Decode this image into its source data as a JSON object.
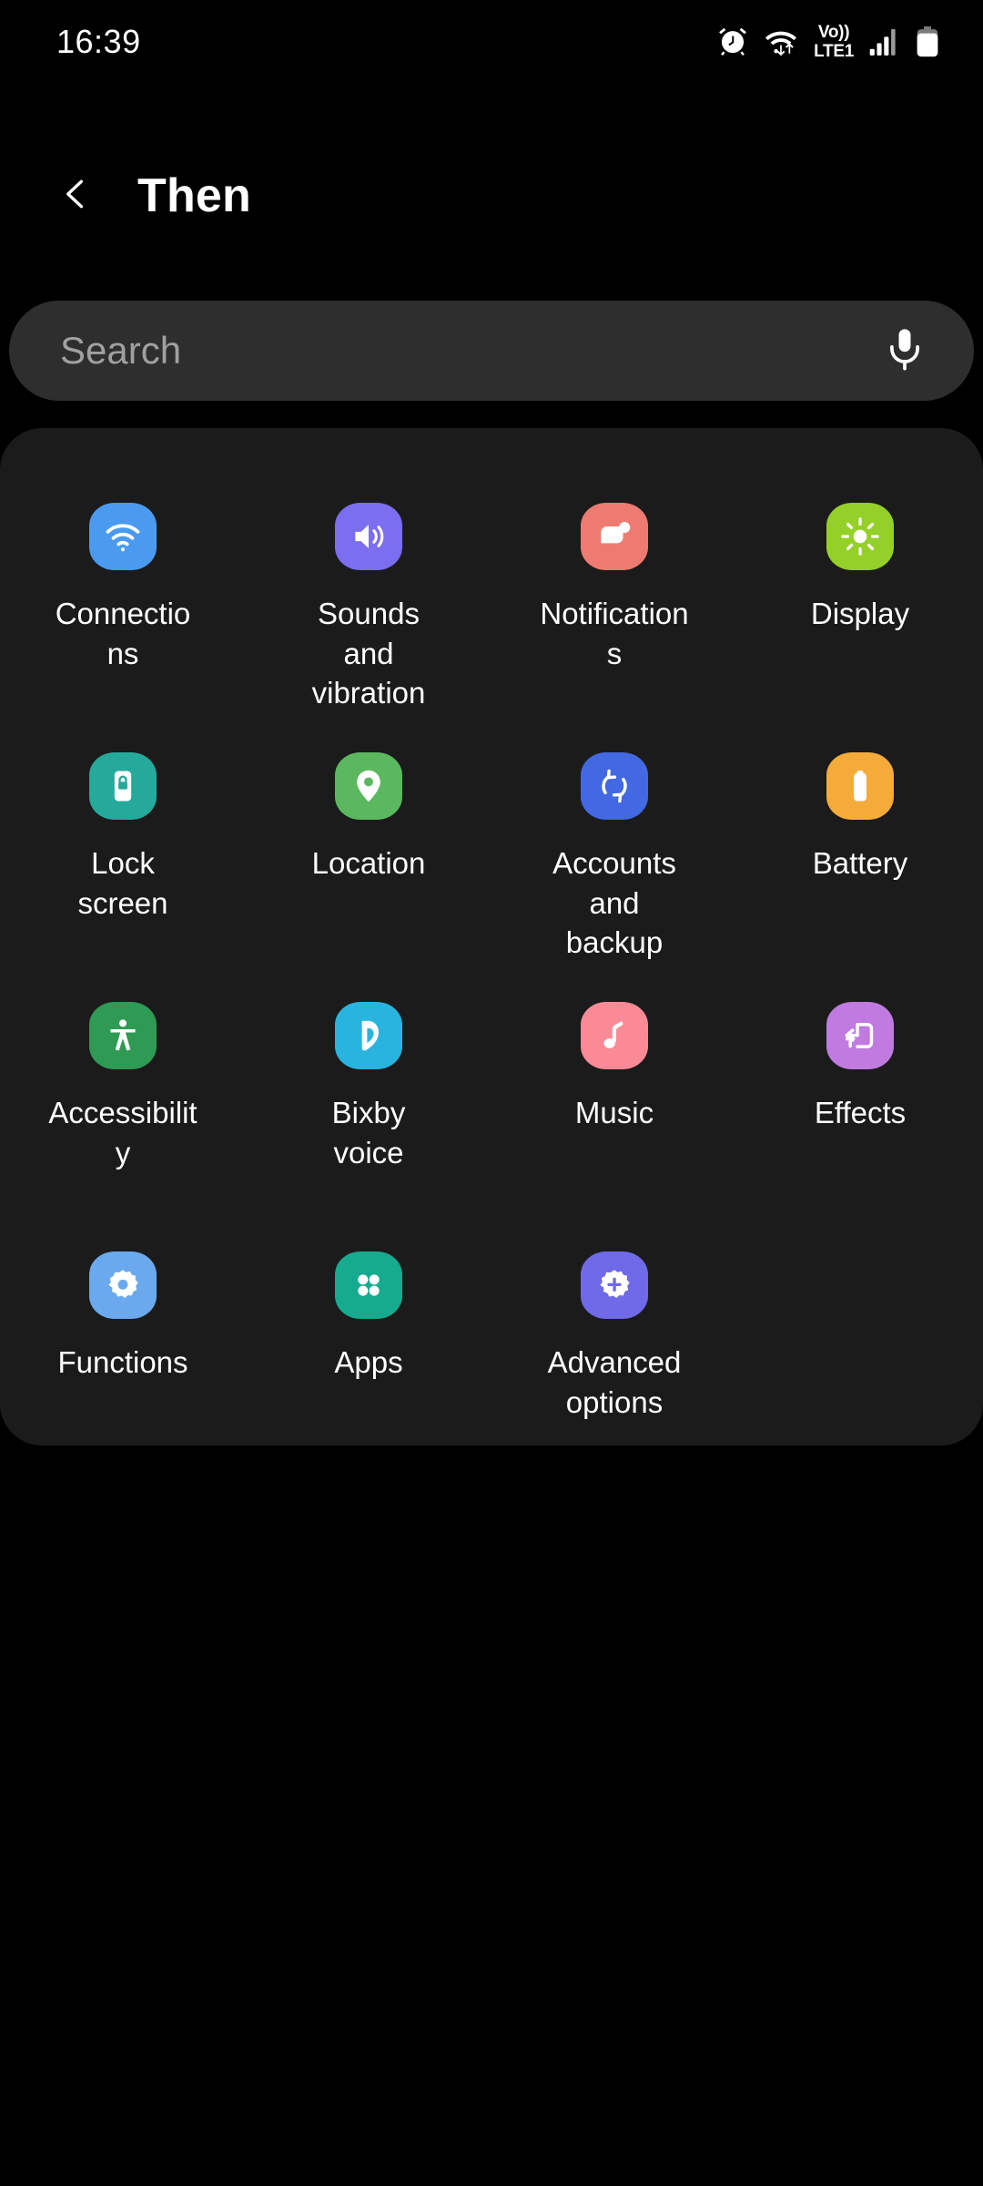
{
  "statusbar": {
    "clock": "16:39",
    "icons": [
      {
        "name": "alarm-icon"
      },
      {
        "name": "wifi-data-transfer-icon"
      },
      {
        "name": "volte-icon",
        "line1": "Vo))",
        "line2": "LTE1"
      },
      {
        "name": "signal-bars-icon"
      },
      {
        "name": "battery-icon"
      }
    ]
  },
  "appbar": {
    "back_icon": "chevron-left-icon",
    "title": "Then"
  },
  "search": {
    "placeholder": "Search",
    "value": "",
    "mic_icon": "microphone-icon"
  },
  "grid": {
    "items": [
      {
        "label": "Connections",
        "icon": "wifi-icon",
        "color": "#4a9bf0"
      },
      {
        "label": "Sounds and vibration",
        "icon": "speaker-volume-icon",
        "color": "#7b6ef0"
      },
      {
        "label": "Notifications",
        "icon": "notification-bubble-icon",
        "color": "#ed7b72"
      },
      {
        "label": "Display",
        "icon": "brightness-sun-icon",
        "color": "#94d027"
      },
      {
        "label": "Lock screen",
        "icon": "lock-icon",
        "color": "#25a99a"
      },
      {
        "label": "Location",
        "icon": "location-pin-icon",
        "color": "#5bb85e"
      },
      {
        "label": "Accounts and backup",
        "icon": "sync-arrows-icon",
        "color": "#4268e2"
      },
      {
        "label": "Battery",
        "icon": "battery-vertical-icon",
        "color": "#f5ab3a"
      },
      {
        "label": "Accessibility",
        "icon": "accessibility-person-icon",
        "color": "#2e9a54"
      },
      {
        "label": "Bixby voice",
        "icon": "bixby-icon",
        "color": "#28b4de"
      },
      {
        "label": "Music",
        "icon": "music-note-icon",
        "color": "#f98a96"
      },
      {
        "label": "Effects",
        "icon": "effects-device-icon",
        "color": "#c07ae0"
      },
      {
        "label": "Functions",
        "icon": "gear-icon",
        "color": "#6aa9ee"
      },
      {
        "label": "Apps",
        "icon": "apps-grid-icon",
        "color": "#16ab8e"
      },
      {
        "label": "Advanced options",
        "icon": "gear-plus-icon",
        "color": "#6f6ae8"
      }
    ]
  },
  "colors": {
    "page_background": "#000000",
    "card_background": "#1b1b1b",
    "search_background": "#2e2e2e",
    "text_primary": "#ffffff",
    "text_placeholder": "#a0a0a0"
  }
}
